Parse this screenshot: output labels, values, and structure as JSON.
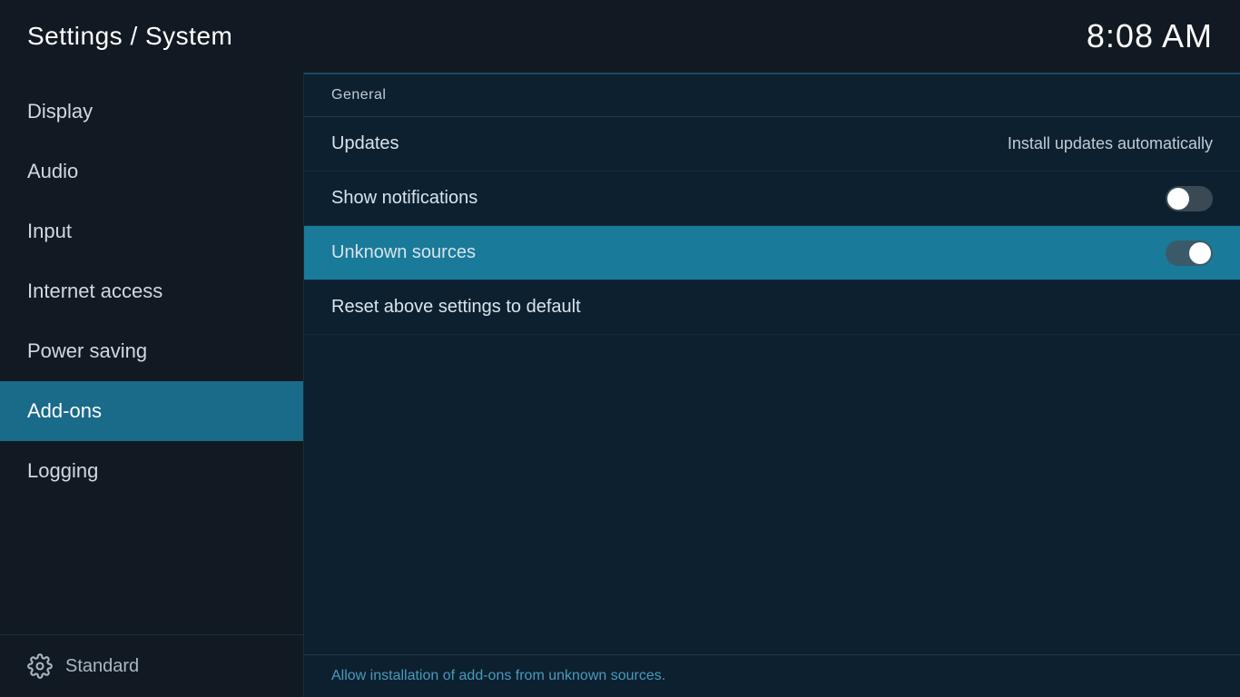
{
  "header": {
    "title": "Settings / System",
    "clock": "8:08 AM"
  },
  "sidebar": {
    "items": [
      {
        "id": "display",
        "label": "Display",
        "active": false
      },
      {
        "id": "audio",
        "label": "Audio",
        "active": false
      },
      {
        "id": "input",
        "label": "Input",
        "active": false
      },
      {
        "id": "internet-access",
        "label": "Internet access",
        "active": false
      },
      {
        "id": "power-saving",
        "label": "Power saving",
        "active": false
      },
      {
        "id": "add-ons",
        "label": "Add-ons",
        "active": true
      },
      {
        "id": "logging",
        "label": "Logging",
        "active": false
      }
    ],
    "footer_label": "Standard",
    "gear_icon": "⚙"
  },
  "content": {
    "section_label": "General",
    "rows": [
      {
        "id": "updates",
        "label": "Updates",
        "value": "Install updates automatically",
        "toggle": null,
        "highlighted": false
      },
      {
        "id": "show-notifications",
        "label": "Show notifications",
        "value": null,
        "toggle": "off",
        "highlighted": false
      },
      {
        "id": "unknown-sources",
        "label": "Unknown sources",
        "value": null,
        "toggle": "on",
        "highlighted": true
      },
      {
        "id": "reset-above",
        "label": "Reset above settings to default",
        "value": null,
        "toggle": null,
        "highlighted": false
      }
    ],
    "footer_hint": "Allow installation of add-ons from unknown sources."
  }
}
